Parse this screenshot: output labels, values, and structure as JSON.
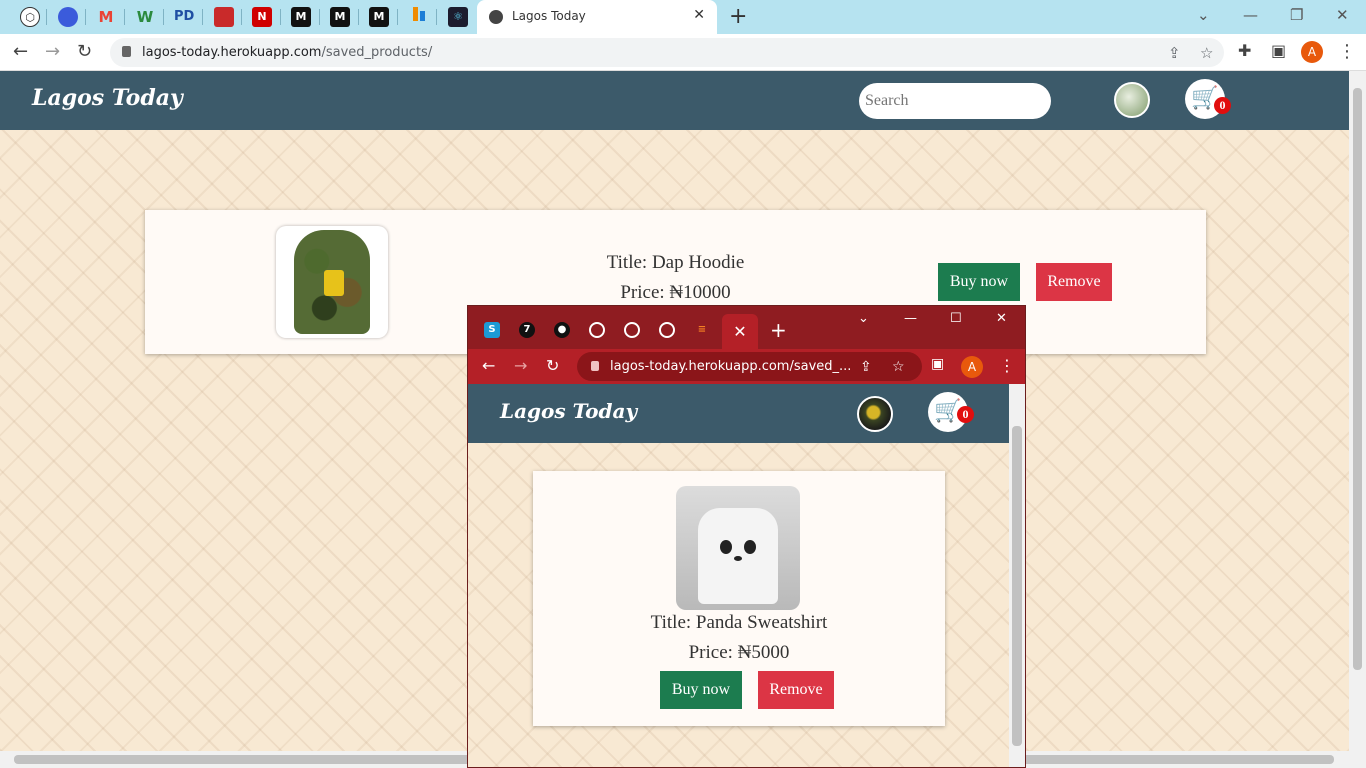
{
  "browser": {
    "active_tab_title": "Lagos Today",
    "pinned_tabs": [
      {
        "icon": "extension-icon",
        "label": "",
        "color": "#ffffff"
      },
      {
        "icon": "app-icon",
        "label": "",
        "color": "#3b5bdb"
      },
      {
        "icon": "gmail-icon",
        "label": "M",
        "color": "#ea4335"
      },
      {
        "icon": "w-icon",
        "label": "W",
        "color": "#2b8a3e"
      },
      {
        "icon": "pd-icon",
        "label": "PD",
        "color": "#1f4fa3"
      },
      {
        "icon": "slides-icon",
        "label": "",
        "color": "#c92a2a"
      },
      {
        "icon": "n-icon",
        "label": "N",
        "color": "#d00000"
      },
      {
        "icon": "medium-icon",
        "label": "M",
        "color": "#111111"
      },
      {
        "icon": "medium-icon",
        "label": "M",
        "color": "#111111"
      },
      {
        "icon": "medium-icon",
        "label": "M",
        "color": "#111111"
      },
      {
        "icon": "bar-icon",
        "label": "",
        "color": "#f08c00"
      },
      {
        "icon": "react-icon",
        "label": "",
        "color": "#1c1c2e"
      }
    ],
    "url_host": "lagos-today.herokuapp.com",
    "url_path": "/saved_products/",
    "profile_initial": "A"
  },
  "site": {
    "logo": "Lagos Today",
    "search_placeholder": "Search",
    "cart_count": "0"
  },
  "saved_products": [
    {
      "title": "Title: Dap Hoodie",
      "price": "Price: ₦10000",
      "buy_label": "Buy now",
      "remove_label": "Remove"
    }
  ],
  "overlay_window": {
    "url": "lagos-today.herokuapp.com/saved_...",
    "profile_initial": "A",
    "logo": "Lagos Today",
    "cart_count": "0",
    "product": {
      "title": "Title: Panda Sweatshirt",
      "price": "Price: ₦5000",
      "buy_label": "Buy now",
      "remove_label": "Remove"
    }
  },
  "colors": {
    "nav_bg": "#3c5a6a",
    "buy_button": "#1c7c4f",
    "remove_button": "#dc3545",
    "tabstrip": "#b6e3f0",
    "overlay_frame": "#8f1c21"
  }
}
